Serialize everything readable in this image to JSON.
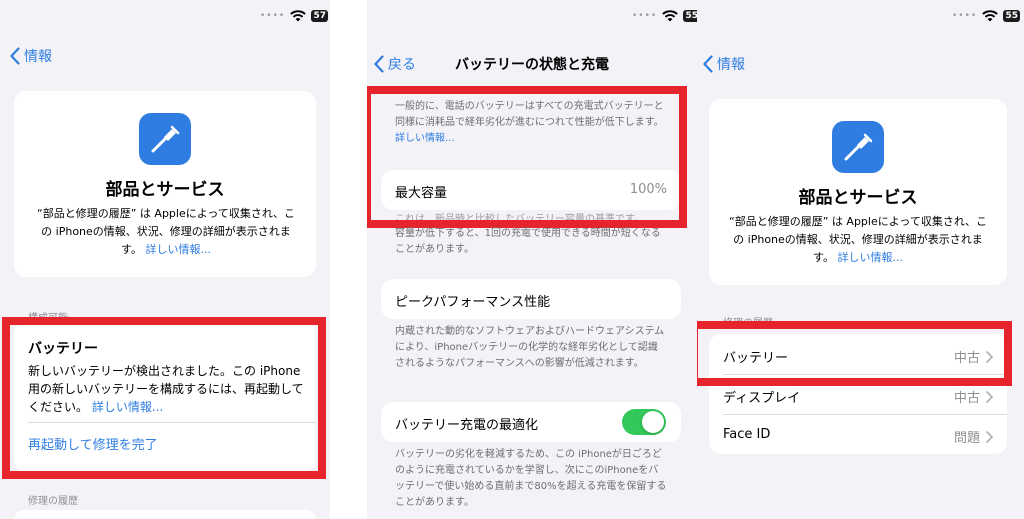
{
  "status_bar": {
    "battery_1": "57",
    "battery_2": "55",
    "battery_3": "55"
  },
  "panel1": {
    "back_label": "情報",
    "card_title": "部品とサービス",
    "card_desc": "“部品と修理の履歴” は Appleによって収集され、この iPhoneの情報、状況、修理の詳細が表示されます。",
    "card_link": "詳しい情報...",
    "section_configurable": "構成可能",
    "battery_title": "バッテリー",
    "battery_message": "新しいバッテリーが検出されました。この iPhone用の新しいバッテリーを構成するには、再起動してください。",
    "battery_link": "詳しい情報...",
    "restart_button": "再起動して修理を完了",
    "section_history": "修理の履歴"
  },
  "panel2": {
    "back_label": "戻る",
    "nav_title": "バッテリーの状態と充電",
    "intro_text": "一般的に、電話のバッテリーはすべての充電式バッテリーと同様に消耗品で経年劣化が進むにつれて性能が低下します。",
    "intro_link": "詳しい情報...",
    "max_capacity_label": "最大容量",
    "max_capacity_value": "100%",
    "capacity_note_hidden": "これは、新品時と比較したバッテリー容量の基準です。",
    "capacity_note": "容量が低下すると、1回の充電で使用できる時間が短くなることがあります。",
    "peak_label": "ピークパフォーマンス性能",
    "peak_note": "内蔵された動的なソフトウェアおよびハードウェアシステムにより、iPhoneバッテリーの化学的な経年劣化として認識されるようなパフォーマンスへの影響が低減されます。",
    "optimize_label": "バッテリー充電の最適化",
    "optimize_on": true,
    "optimize_note": "バッテリーの劣化を軽減するため、この iPhoneが日ごろどのように充電されているかを学習し、次にこのiPhoneをバッテリーで使い始める直前まで80%を超える充電を保留することがあります。"
  },
  "panel3": {
    "back_label": "情報",
    "card_title": "部品とサービス",
    "card_desc": "“部品と修理の履歴” は Appleによって収集され、この iPhoneの情報、状況、修理の詳細が表示されます。",
    "card_link": "詳しい情報...",
    "section_history": "修理の履歴",
    "rows": [
      {
        "label": "バッテリー",
        "value": "中古"
      },
      {
        "label": "ディスプレイ",
        "value": "中古"
      },
      {
        "label": "Face ID",
        "value": "問題"
      }
    ]
  },
  "colors": {
    "accent_blue": "#2f7de1",
    "highlight_red": "#e5242b",
    "toggle_green": "#34c759",
    "background": "#f2f2f7"
  },
  "icons": [
    "chevron-left-icon",
    "wifi-icon",
    "battery-icon",
    "screwdriver-icon",
    "chevron-right-icon"
  ]
}
